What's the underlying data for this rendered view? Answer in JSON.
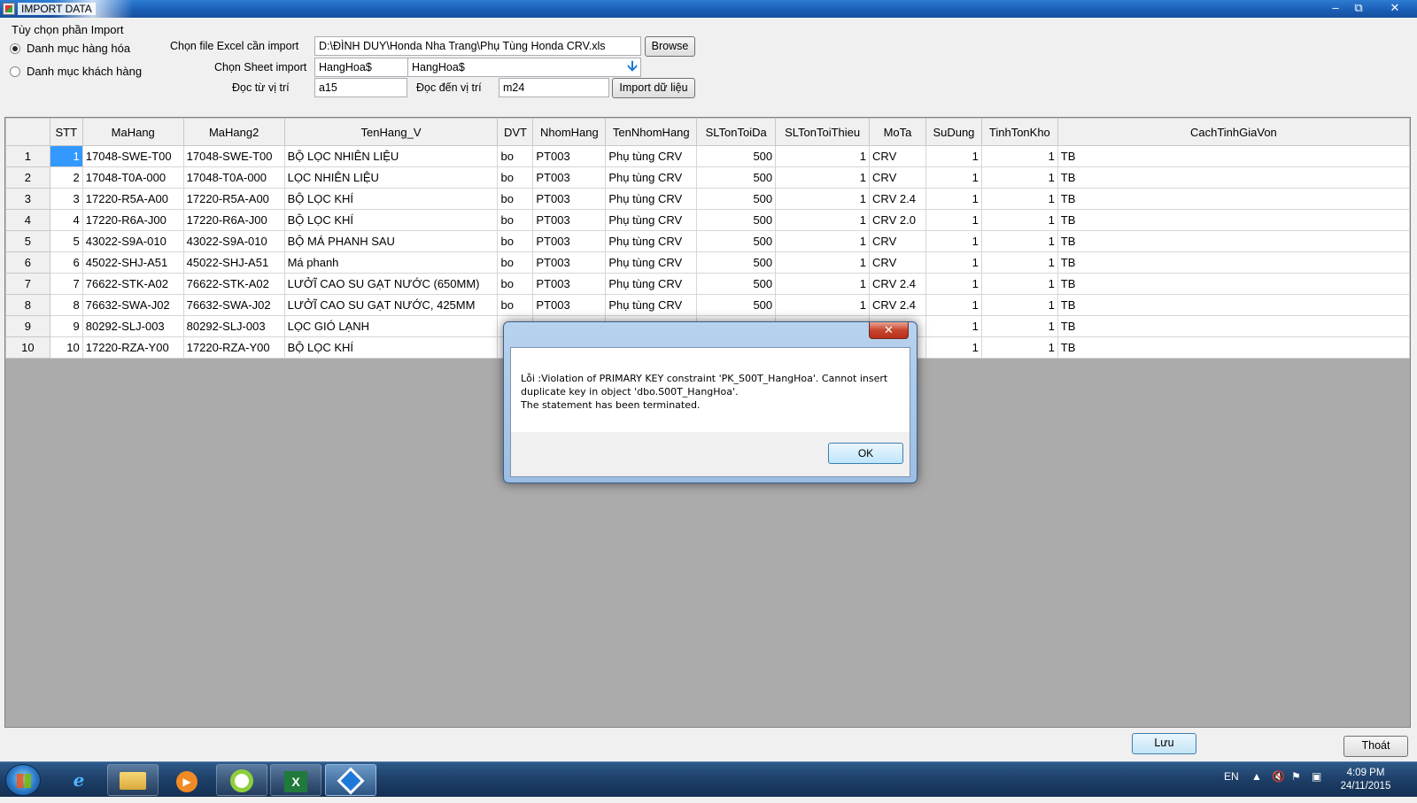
{
  "window": {
    "title": "IMPORT DATA",
    "minimize_glyph": "–",
    "maximize_glyph": "⧉",
    "close_glyph": "✕"
  },
  "options": {
    "group_label": "Tùy chọn phần Import",
    "radio_products": "Danh mục hàng hóa",
    "radio_products_checked": true,
    "radio_customers": "Danh mục khách hàng",
    "radio_customers_checked": false
  },
  "file": {
    "label": "Chọn file Excel cần import",
    "value": "D:\\ĐÌNH DUY\\Honda Nha Trang\\Phụ Tùng Honda CRV.xls",
    "browse_label": "Browse"
  },
  "sheet": {
    "label": "Chọn Sheet import",
    "value1": "HangHoa$",
    "value2": "HangHoa$",
    "arrow_icon": "down-arrow-icon"
  },
  "range": {
    "from_label": "Đọc từ vị trí",
    "from_value": "a15",
    "to_label": "Đọc đến vị trí",
    "to_value": "m24",
    "import_label": "Import dữ liệu"
  },
  "grid": {
    "columns": [
      "STT",
      "MaHang",
      "MaHang2",
      "TenHang_V",
      "DVT",
      "NhomHang",
      "TenNhomHang",
      "SLTonToiDa",
      "SLTonToiThieu",
      "MoTa",
      "SuDung",
      "TinhTonKho",
      "CachTinhGiaVon"
    ],
    "rows": [
      {
        "rh": "1",
        "c": [
          "1",
          "17048-SWE-T00",
          "17048-SWE-T00",
          "BỘ LỌC NHIÊN LIỆU",
          "bo",
          "PT003",
          "Phụ tùng CRV",
          "500",
          "1",
          "CRV",
          "1",
          "1",
          "TB"
        ]
      },
      {
        "rh": "2",
        "c": [
          "2",
          "17048-T0A-000",
          "17048-T0A-000",
          "LỌC NHIÊN LIỆU",
          "bo",
          "PT003",
          "Phụ tùng CRV",
          "500",
          "1",
          "CRV",
          "1",
          "1",
          "TB"
        ]
      },
      {
        "rh": "3",
        "c": [
          "3",
          "17220-R5A-A00",
          "17220-R5A-A00",
          "BỘ LỌC KHÍ",
          "bo",
          "PT003",
          "Phụ tùng CRV",
          "500",
          "1",
          "CRV 2.4",
          "1",
          "1",
          "TB"
        ]
      },
      {
        "rh": "4",
        "c": [
          "4",
          "17220-R6A-J00",
          "17220-R6A-J00",
          "BỘ LỌC KHÍ",
          "bo",
          "PT003",
          "Phụ tùng CRV",
          "500",
          "1",
          "CRV 2.0",
          "1",
          "1",
          "TB"
        ]
      },
      {
        "rh": "5",
        "c": [
          "5",
          "43022-S9A-010",
          "43022-S9A-010",
          "BỘ MÁ PHANH SAU",
          "bo",
          "PT003",
          "Phụ tùng CRV",
          "500",
          "1",
          "CRV",
          "1",
          "1",
          "TB"
        ]
      },
      {
        "rh": "6",
        "c": [
          "6",
          "45022-SHJ-A51",
          "45022-SHJ-A51",
          "Má phanh",
          "bo",
          "PT003",
          "Phụ tùng CRV",
          "500",
          "1",
          "CRV",
          "1",
          "1",
          "TB"
        ]
      },
      {
        "rh": "7",
        "c": [
          "7",
          "76622-STK-A02",
          "76622-STK-A02",
          "LƯỞĨ CAO SU GẠT NƯỚC (650MM)",
          "bo",
          "PT003",
          "Phụ tùng CRV",
          "500",
          "1",
          "CRV 2.4",
          "1",
          "1",
          "TB"
        ]
      },
      {
        "rh": "8",
        "c": [
          "8",
          "76632-SWA-J02",
          "76632-SWA-J02",
          "LƯỞĨ CAO SU GẠT NƯỚC, 425MM",
          "bo",
          "PT003",
          "Phụ tùng CRV",
          "500",
          "1",
          "CRV 2.4",
          "1",
          "1",
          "TB"
        ]
      },
      {
        "rh": "9",
        "c": [
          "9",
          "80292-SLJ-003",
          "80292-SLJ-003",
          "LỌC GIÓ LẠNH",
          "",
          "",
          "",
          "",
          "",
          "",
          "1",
          "1",
          "TB"
        ]
      },
      {
        "rh": "10",
        "c": [
          "10",
          "17220-RZA-Y00",
          "17220-RZA-Y00",
          "BỘ LỌC KHÍ",
          "",
          "",
          "",
          "",
          "",
          "",
          "1",
          "1",
          "TB"
        ]
      }
    ],
    "selected_cell_color": "#3399ff"
  },
  "dialog": {
    "close_glyph": "✕",
    "line1": "Lỗi :Violation of PRIMARY KEY constraint 'PK_S00T_HangHoa'. Cannot insert",
    "line2": "duplicate key in object 'dbo.S00T_HangHoa'.",
    "line3": "The statement has been terminated.",
    "ok_label": "OK"
  },
  "footer": {
    "save_label": "Lưu",
    "exit_label": "Thoát"
  },
  "taskbar": {
    "items": [
      "internet-explorer-icon",
      "file-explorer-icon",
      "media-player-icon",
      "chrome-like-icon",
      "excel-icon",
      "app-icon"
    ],
    "language": "EN",
    "time": "4:09 PM",
    "date": "24/11/2015"
  }
}
